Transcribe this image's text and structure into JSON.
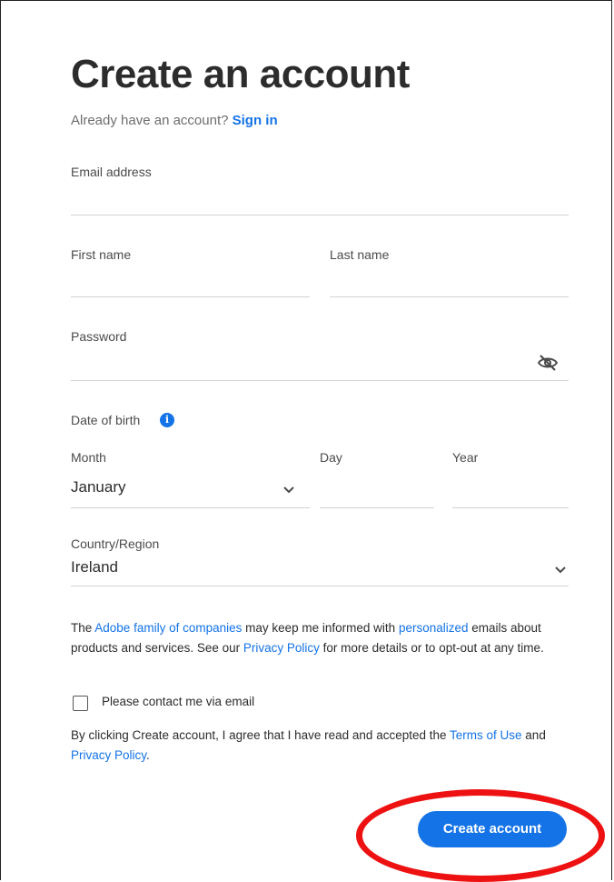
{
  "page": {
    "title": "Create an account",
    "already_text": "Already have an account?",
    "sign_in_label": "Sign in"
  },
  "form": {
    "email_label": "Email address",
    "email_value": "",
    "first_name_label": "First name",
    "first_name_value": "",
    "last_name_label": "Last name",
    "last_name_value": "",
    "password_label": "Password",
    "password_value": "",
    "dob_label": "Date of birth",
    "month_label": "Month",
    "month_value": "January",
    "day_label": "Day",
    "day_value": "",
    "year_label": "Year",
    "year_value": "",
    "country_label": "Country/Region",
    "country_value": "Ireland"
  },
  "consent": {
    "p1_a": "The ",
    "p1_link1": "Adobe family of companies",
    "p1_b": " may keep me informed with ",
    "p1_link2": "personalized",
    "p1_c": " emails about products and services. See our ",
    "p1_link3": "Privacy Policy",
    "p1_d": " for more details or to opt-out at any time.",
    "checkbox_label": "Please contact me via email",
    "checkbox_checked": false,
    "p2_a": "By clicking Create account, I agree that I have read and accepted the ",
    "p2_link1": "Terms of Use",
    "p2_b": " and ",
    "p2_link2": "Privacy Policy",
    "p2_c": "."
  },
  "actions": {
    "create_account_label": "Create account"
  },
  "icons": {
    "password_toggle": "eye-slash-icon",
    "dob_info": "info-icon",
    "month_dropdown": "chevron-down-icon",
    "country_dropdown": "chevron-down-icon"
  },
  "colors": {
    "accent": "#1473e6",
    "annotation": "#ee1111"
  }
}
